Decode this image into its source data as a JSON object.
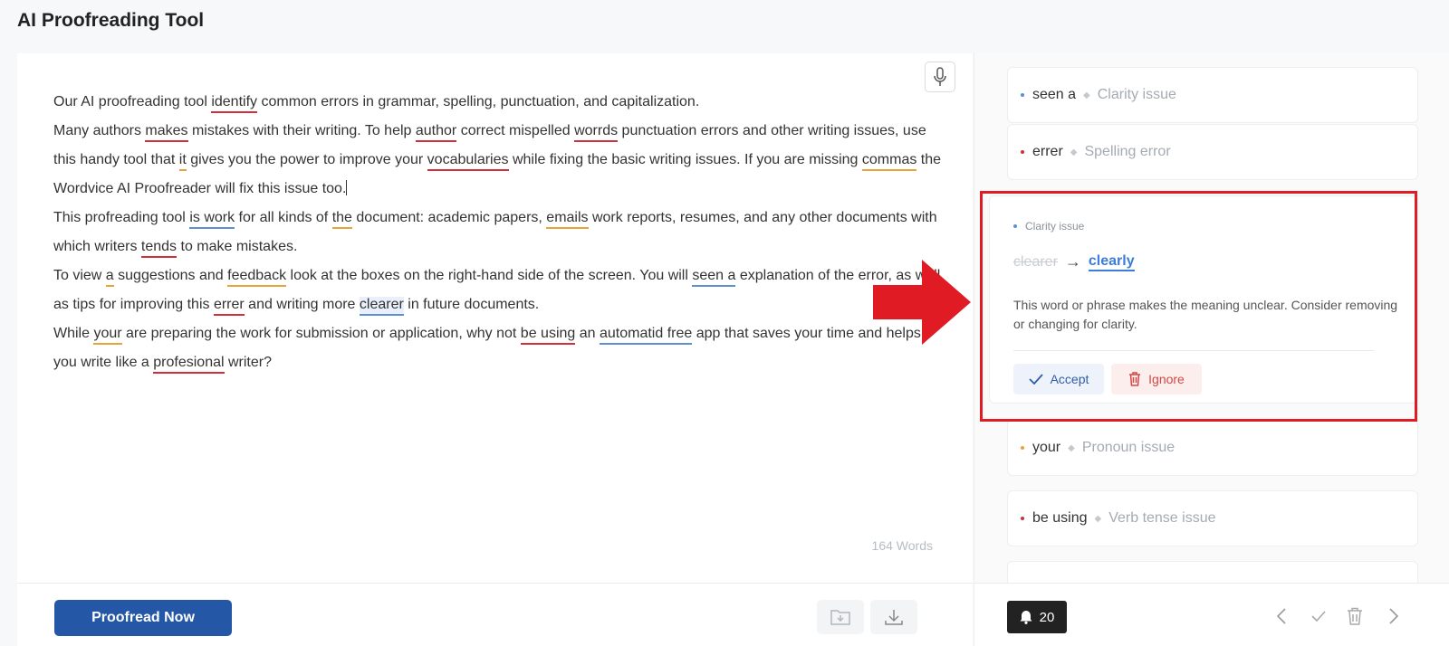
{
  "app": {
    "title": "AI Proofreading Tool"
  },
  "editor": {
    "lines": [
      [
        {
          "t": "Our AI proofreading tool "
        },
        {
          "t": "identify",
          "c": "red"
        },
        {
          "t": " common errors in grammar, spelling, punctuation, and capitalization."
        }
      ],
      [
        {
          "t": "Many authors "
        },
        {
          "t": "makes",
          "c": "red"
        },
        {
          "t": " mistakes with their writing. To help "
        },
        {
          "t": "author",
          "c": "red"
        },
        {
          "t": " correct mispelled "
        },
        {
          "t": "worrds",
          "c": "red"
        },
        {
          "t": " punctuation errors and other writing issues, use this handy tool that "
        },
        {
          "t": "it",
          "c": "orange"
        },
        {
          "t": " gives you the power to improve your "
        },
        {
          "t": "vocabularies",
          "c": "red"
        },
        {
          "t": " while fixing the basic writing issues. If you are missing "
        },
        {
          "t": "commas",
          "c": "orange"
        },
        {
          "t": " the Wordvice AI Proofreader will fix this issue too."
        },
        {
          "caret": true
        }
      ],
      [
        {
          "t": "This profreading tool "
        },
        {
          "t": "is work",
          "c": "blue"
        },
        {
          "t": " for all kinds of "
        },
        {
          "t": "the",
          "c": "orange"
        },
        {
          "t": " document: academic papers, "
        },
        {
          "t": "emails",
          "c": "orange"
        },
        {
          "t": " work reports, resumes, and any other documents with which writers "
        },
        {
          "t": "tends",
          "c": "red"
        },
        {
          "t": " to make mistakes."
        }
      ],
      [
        {
          "t": "To view "
        },
        {
          "t": "a",
          "c": "orange"
        },
        {
          "t": " suggestions and "
        },
        {
          "t": "feedback",
          "c": "orange"
        },
        {
          "t": " look at the boxes on the right-hand side of the screen. You will "
        },
        {
          "t": "seen a",
          "c": "blue"
        },
        {
          "t": " explanation of the error, as well as tips for improving this "
        },
        {
          "t": "errer",
          "c": "red"
        },
        {
          "t": " and writing more "
        },
        {
          "t": "clearer",
          "c": "blue",
          "hl": true
        },
        {
          "t": " in future documents."
        }
      ],
      [
        {
          "t": "While "
        },
        {
          "t": "your",
          "c": "orange"
        },
        {
          "t": " are preparing the work for submission or application, why not "
        },
        {
          "t": "be using",
          "c": "red"
        },
        {
          "t": " an "
        },
        {
          "t": "automatid free",
          "c": "blue"
        },
        {
          "t": " app that saves your time and helps you write like a "
        },
        {
          "t": "profesional",
          "c": "red"
        },
        {
          "t": " writer?"
        }
      ]
    ],
    "word_count": "164 Words",
    "proofread_label": "Proofread Now"
  },
  "suggestions": {
    "cards": [
      {
        "word": "seen a",
        "category": "Clarity issue",
        "dot_color": "#5e8fd0"
      },
      {
        "word": "errer",
        "category": "Spelling error",
        "dot_color": "#d32f3a"
      },
      {
        "word": "your",
        "category": "Pronoun issue",
        "dot_color": "#e8a33b"
      },
      {
        "word": "be using",
        "category": "Verb tense issue",
        "dot_color": "#d32f3a"
      }
    ],
    "expanded": {
      "category": "Clarity issue",
      "original": "clearer",
      "arrow": "→",
      "suggestion": "clearly",
      "description": "This word or phrase makes the meaning unclear. Consider removing or changing for clarity.",
      "accept_label": "Accept",
      "ignore_label": "Ignore"
    },
    "count": "20"
  },
  "colors": {
    "red": "#d32f3a",
    "orange": "#e8a33b",
    "blue": "#5e8fd0",
    "primary": "#2557a7",
    "annotation": "#e01b24"
  },
  "icons": [
    "microphone-icon",
    "folder-import-icon",
    "download-icon",
    "bell-icon",
    "chevron-left-icon",
    "check-icon",
    "trash-icon",
    "chevron-right-icon"
  ]
}
